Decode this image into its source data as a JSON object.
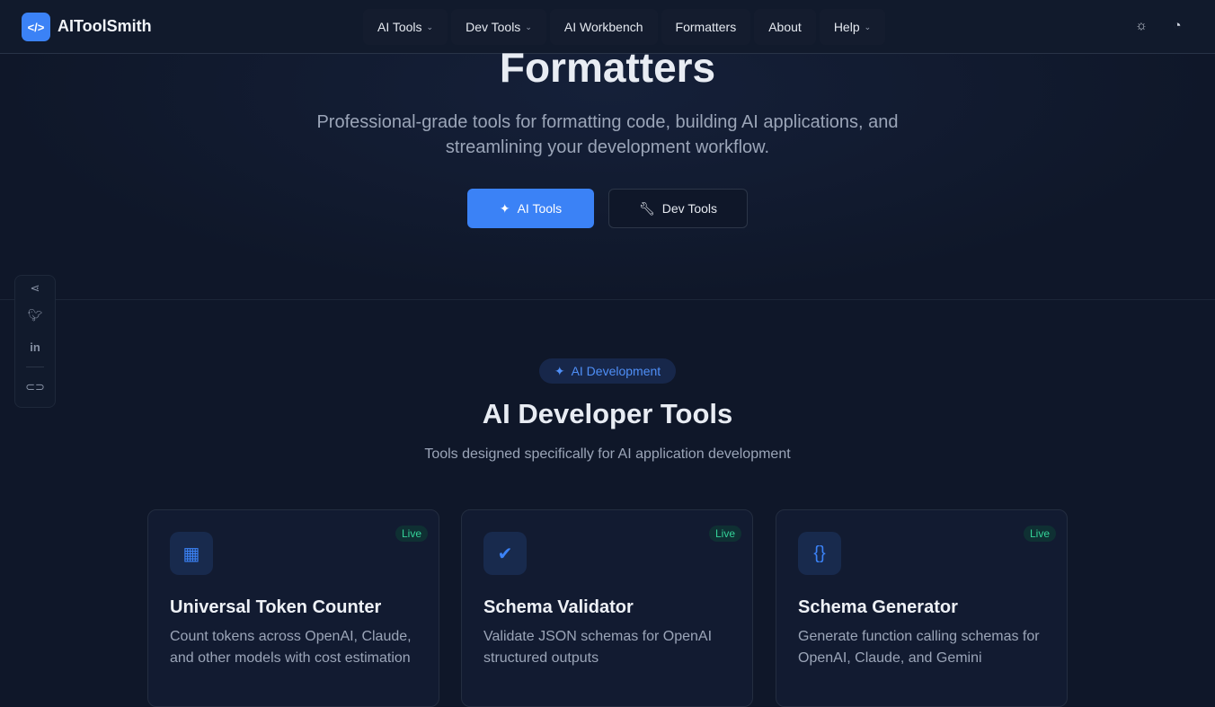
{
  "brand": {
    "name": "AIToolSmith",
    "logo": "</>"
  },
  "nav": {
    "items": [
      {
        "label": "AI Tools",
        "dropdown": true
      },
      {
        "label": "Dev Tools",
        "dropdown": true
      },
      {
        "label": "AI Workbench"
      },
      {
        "label": "Formatters"
      },
      {
        "label": "About"
      },
      {
        "label": "Help",
        "dropdown": true
      }
    ]
  },
  "hero": {
    "title": "Formatters",
    "subtitle": "Professional-grade tools for formatting code, building AI applications, and streamlining your development workflow.",
    "primary_button": "AI Tools",
    "secondary_button": "Dev Tools"
  },
  "section": {
    "badge": "AI Development",
    "title": "AI Developer Tools",
    "subtitle": "Tools designed specifically for AI application development"
  },
  "cards": [
    {
      "title": "Universal Token Counter",
      "description": "Count tokens across OpenAI, Claude, and other models with cost estimation",
      "badge": "Live",
      "icon": "calculator-icon"
    },
    {
      "title": "Schema Validator",
      "description": "Validate JSON schemas for OpenAI structured outputs",
      "badge": "Live",
      "icon": "check-circle-icon"
    },
    {
      "title": "Schema Generator",
      "description": "Generate function calling schemas for OpenAI, Claude, and Gemini",
      "badge": "Live",
      "icon": "file-code-icon"
    }
  ],
  "colors": {
    "accent": "#3b82f6",
    "live": "#34d399",
    "bg": "#0f1729"
  }
}
